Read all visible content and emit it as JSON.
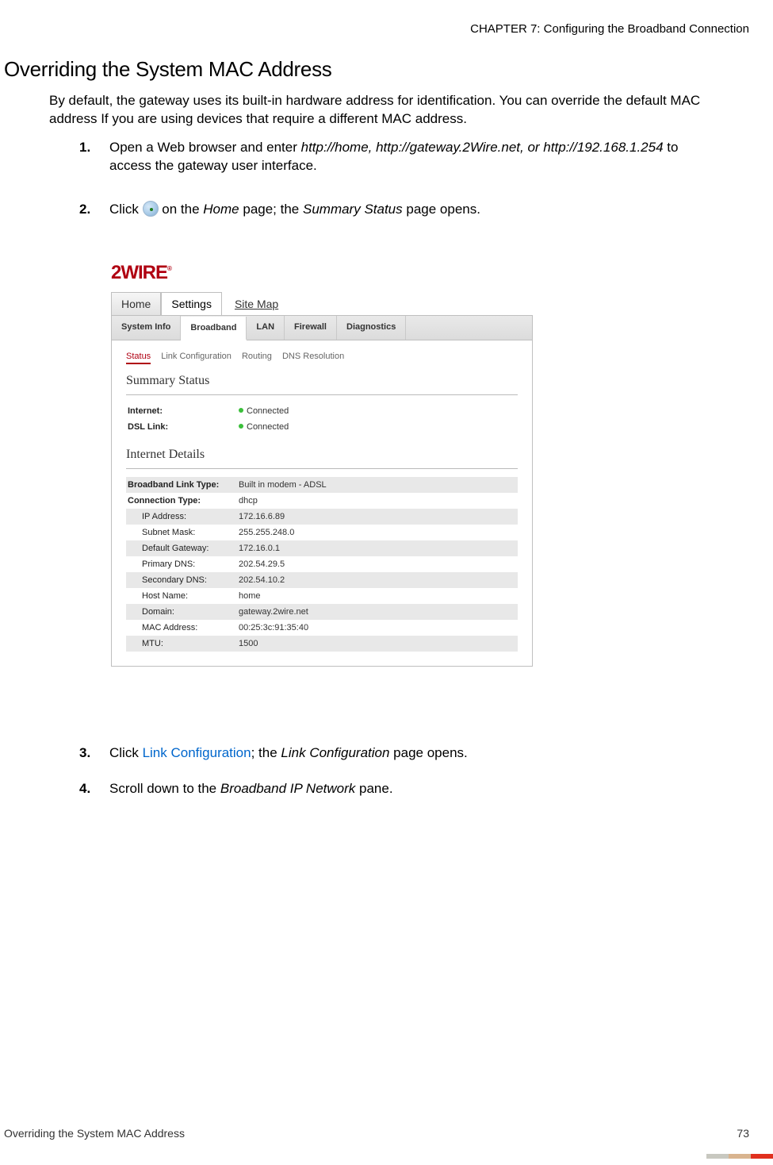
{
  "chapter_header": "CHAPTER 7: Configuring the Broadband Connection",
  "section_title": "Overriding the System MAC Address",
  "intro": "By default, the gateway uses its built-in hardware address for identification. You can override the default MAC address If you are using devices that require a different MAC address.",
  "steps": {
    "s1": {
      "num": "1.",
      "a": "Open a Web browser and enter ",
      "b": "http://home, http://gateway.2Wire.net, or http://192.168.1.254",
      "c": " to access the gateway user interface."
    },
    "s2": {
      "num": "2.",
      "a": "Click ",
      "b": " on the ",
      "c": "Home",
      "d": " page; the ",
      "e": "Summary Status",
      "f": " page opens."
    },
    "s3": {
      "num": "3.",
      "a": "Click ",
      "link": "Link Configuration",
      "b": "; the ",
      "c": "Link Configuration",
      "d": " page opens."
    },
    "s4": {
      "num": "4.",
      "a": "Scroll down to the ",
      "b": "Broadband IP Network",
      "c": " pane."
    }
  },
  "logo": "2WIRE",
  "tabs1": {
    "home": "Home",
    "settings": "Settings",
    "sitemap": "Site Map"
  },
  "tabs2": {
    "system_info": "System Info",
    "broadband": "Broadband",
    "lan": "LAN",
    "firewall": "Firewall",
    "diagnostics": "Diagnostics"
  },
  "subtabs": {
    "status": "Status",
    "linkconfig": "Link Configuration",
    "routing": "Routing",
    "dns": "DNS Resolution"
  },
  "sections": {
    "summary": "Summary Status",
    "details": "Internet Details"
  },
  "summary": {
    "internet_label": "Internet:",
    "internet_val": "Connected",
    "dsl_label": "DSL Link:",
    "dsl_val": "Connected"
  },
  "details": {
    "blt_label": "Broadband Link Type:",
    "blt_val": "Built in modem - ADSL",
    "ct_label": "Connection Type:",
    "ct_val": "dhcp",
    "ip_label": "IP Address:",
    "ip_val": "172.16.6.89",
    "mask_label": "Subnet Mask:",
    "mask_val": "255.255.248.0",
    "gw_label": "Default Gateway:",
    "gw_val": "172.16.0.1",
    "pdns_label": "Primary DNS:",
    "pdns_val": "202.54.29.5",
    "sdns_label": "Secondary DNS:",
    "sdns_val": "202.54.10.2",
    "host_label": "Host Name:",
    "host_val": "home",
    "domain_label": "Domain:",
    "domain_val": "gateway.2wire.net",
    "mac_label": "MAC Address:",
    "mac_val": "00:25:3c:91:35:40",
    "mtu_label": "MTU:",
    "mtu_val": "1500"
  },
  "footer": {
    "left": "Overriding the System MAC Address",
    "right": "73"
  }
}
